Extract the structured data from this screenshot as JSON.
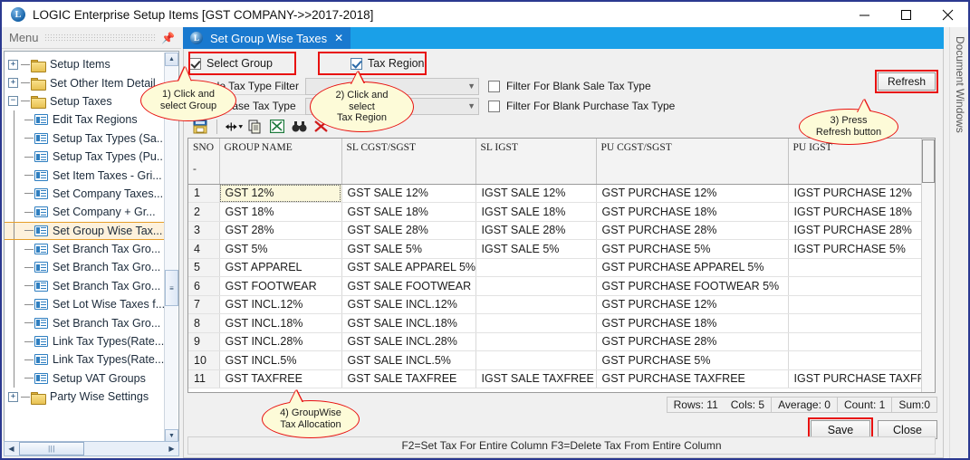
{
  "window": {
    "title": "LOGIC Enterprise Setup Items  [GST COMPANY->>2017-2018]",
    "logo_letter": "L",
    "minimize_label": "Minimize",
    "maximize_label": "Maximize",
    "close_label": "Close"
  },
  "sidebar": {
    "header": "Menu",
    "pin_label": "Auto Hide",
    "items": [
      {
        "label": "Setup Items",
        "type": "folder",
        "state": "collapsed",
        "indent": 1
      },
      {
        "label": "Set Other Item Detail",
        "type": "folder",
        "state": "collapsed",
        "indent": 1
      },
      {
        "label": "Setup Taxes",
        "type": "folder",
        "state": "expanded",
        "indent": 1
      },
      {
        "label": "Edit Tax Regions",
        "type": "doc",
        "indent": 2
      },
      {
        "label": "Setup Tax Types (Sa...",
        "type": "doc",
        "indent": 2
      },
      {
        "label": "Setup Tax Types (Pu...",
        "type": "doc",
        "indent": 2
      },
      {
        "label": "Set Item Taxes - Gri...",
        "type": "doc",
        "indent": 2
      },
      {
        "label": "Set Company Taxes...",
        "type": "doc",
        "indent": 2
      },
      {
        "label": "Set Company + Gr...",
        "type": "doc",
        "indent": 2
      },
      {
        "label": "Set Group Wise Tax...",
        "type": "doc",
        "indent": 2,
        "selected": true
      },
      {
        "label": "Set Branch Tax Gro...",
        "type": "doc",
        "indent": 2
      },
      {
        "label": "Set Branch Tax Gro...",
        "type": "doc",
        "indent": 2
      },
      {
        "label": "Set Branch Tax Gro...",
        "type": "doc",
        "indent": 2
      },
      {
        "label": "Set Lot Wise Taxes f...",
        "type": "doc",
        "indent": 2
      },
      {
        "label": "Set Branch Tax Gro...",
        "type": "doc",
        "indent": 2
      },
      {
        "label": "Link Tax Types(Rate...",
        "type": "doc",
        "indent": 2
      },
      {
        "label": "Link Tax Types(Rate...",
        "type": "doc",
        "indent": 2
      },
      {
        "label": "Setup VAT Groups",
        "type": "doc",
        "indent": 2
      },
      {
        "label": "Party Wise Settings",
        "type": "folder",
        "state": "collapsed",
        "indent": 1
      }
    ]
  },
  "dockstrip": {
    "label": "Document Windows"
  },
  "tab": {
    "label": "Set Group Wise Taxes",
    "close": "✕",
    "logo_letter": "L"
  },
  "filters": {
    "select_group": {
      "label": "Select Group",
      "checked": true
    },
    "tax_region": {
      "label": "Tax Region",
      "checked": true
    },
    "sale_tax_type_filter": {
      "label": "Sale Tax Type Filter",
      "value": ""
    },
    "purchase_tax_type_filter": {
      "label": "Purchase Tax Type Filter",
      "value": ""
    },
    "blank_sale": {
      "label": "Filter For Blank Sale Tax Type",
      "checked": false
    },
    "blank_purchase": {
      "label": "Filter For Blank Purchase Tax Type",
      "checked": false
    },
    "refresh_label": "Refresh"
  },
  "toolbar": {
    "icons": [
      {
        "name": "print-icon"
      },
      {
        "name": "column-width-icon"
      },
      {
        "name": "copy-icon"
      },
      {
        "name": "export-excel-icon"
      },
      {
        "name": "find-icon"
      },
      {
        "name": "delete-icon"
      }
    ]
  },
  "grid": {
    "columns": [
      "SNO\n-",
      "GROUP NAME",
      "SL CGST/SGST",
      "SL IGST",
      "PU CGST/SGST",
      "PU IGST"
    ],
    "col_sno": "SNO",
    "col_sno_sub": "-",
    "col_group": "GROUP NAME",
    "col_sl_cgst": "SL CGST/SGST",
    "col_sl_igst": "SL IGST",
    "col_pu_cgst": "PU CGST/SGST",
    "col_pu_igst": "PU IGST",
    "rows": [
      {
        "sno": "1",
        "group": "GST 12%",
        "sl_cgst": "GST SALE 12%",
        "sl_igst": "IGST SALE 12%",
        "pu_cgst": "GST PURCHASE 12%",
        "pu_igst": "IGST PURCHASE  12%"
      },
      {
        "sno": "2",
        "group": "GST 18%",
        "sl_cgst": "GST SALE 18%",
        "sl_igst": "IGST SALE 18%",
        "pu_cgst": "GST PURCHASE 18%",
        "pu_igst": "IGST PURCHASE 18%"
      },
      {
        "sno": "3",
        "group": "GST 28%",
        "sl_cgst": "GST SALE 28%",
        "sl_igst": "IGST SALE 28%",
        "pu_cgst": "GST PURCHASE 28%",
        "pu_igst": "IGST PURCHASE 28%"
      },
      {
        "sno": "4",
        "group": "GST 5%",
        "sl_cgst": "GST SALE 5%",
        "sl_igst": "IGST SALE 5%",
        "pu_cgst": "GST PURCHASE 5%",
        "pu_igst": "IGST PURCHASE 5%"
      },
      {
        "sno": "5",
        "group": "GST APPAREL",
        "sl_cgst": "GST SALE APPAREL 5%",
        "sl_igst": "",
        "pu_cgst": "GST PURCHASE APPAREL 5%",
        "pu_igst": ""
      },
      {
        "sno": "6",
        "group": "GST FOOTWEAR",
        "sl_cgst": "GST SALE FOOTWEAR",
        "sl_igst": "",
        "pu_cgst": "GST PURCHASE FOOTWEAR 5%",
        "pu_igst": ""
      },
      {
        "sno": "7",
        "group": "GST INCL.12%",
        "sl_cgst": "GST SALE INCL.12%",
        "sl_igst": "",
        "pu_cgst": "GST PURCHASE 12%",
        "pu_igst": ""
      },
      {
        "sno": "8",
        "group": "GST INCL.18%",
        "sl_cgst": "GST SALE INCL.18%",
        "sl_igst": "",
        "pu_cgst": "GST PURCHASE 18%",
        "pu_igst": ""
      },
      {
        "sno": "9",
        "group": "GST INCL.28%",
        "sl_cgst": "GST SALE INCL.28%",
        "sl_igst": "",
        "pu_cgst": "GST PURCHASE 28%",
        "pu_igst": ""
      },
      {
        "sno": "10",
        "group": "GST INCL.5%",
        "sl_cgst": "GST SALE INCL.5%",
        "sl_igst": "",
        "pu_cgst": "GST PURCHASE 5%",
        "pu_igst": ""
      },
      {
        "sno": "11",
        "group": "GST TAXFREE",
        "sl_cgst": "GST SALE TAXFREE",
        "sl_igst": "IGST SALE TAXFREE",
        "pu_cgst": "GST PURCHASE TAXFREE",
        "pu_igst": "IGST PURCHASE TAXFREE"
      }
    ]
  },
  "status": {
    "rows": "Rows: 11",
    "cols": "Cols: 5",
    "average": "Average: 0",
    "count": "Count: 1",
    "sum": "Sum:0"
  },
  "buttons": {
    "save": "Save",
    "close": "Close"
  },
  "footer": {
    "hint": "F2=Set Tax For Entire Column  F3=Delete Tax From Entire Column"
  },
  "callouts": {
    "c1": "1) Click and\nselect Group",
    "c2": "2) Click and\nselect\nTax Region",
    "c3": "3) Press\nRefresh button",
    "c4": "4) GroupWise\nTax Allocation"
  },
  "colors": {
    "accent_blue": "#1979cf",
    "tab_strip": "#1aa0e8",
    "highlight_red": "#e8100f",
    "selection_orange": "#e59e2a",
    "callout_fill": "#fdfbd8"
  }
}
